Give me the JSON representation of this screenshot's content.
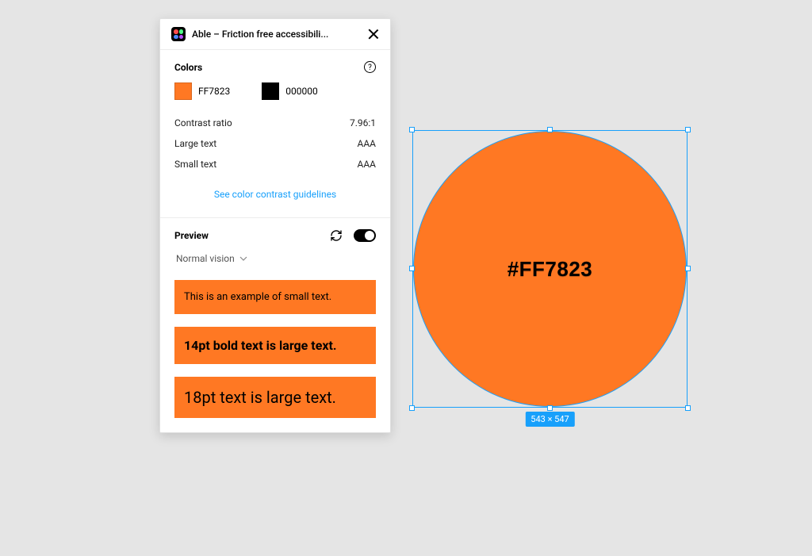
{
  "header": {
    "title": "Able – Friction free accessibili..."
  },
  "colors_section": {
    "title": "Colors",
    "help": "?",
    "color1": {
      "hex": "FF7823",
      "cssHex": "#FF7823"
    },
    "color2": {
      "hex": "000000",
      "cssHex": "#000000"
    },
    "metrics": {
      "contrast_label": "Contrast ratio",
      "contrast_value": "7.96:1",
      "large_label": "Large text",
      "large_value": "AAA",
      "small_label": "Small text",
      "small_value": "AAA"
    },
    "guidelines_link": "See color contrast guidelines"
  },
  "preview_section": {
    "title": "Preview",
    "vision_mode": "Normal vision",
    "samples": {
      "small": "This is an example of small text.",
      "bold": "14pt bold text is large text.",
      "large": "18pt text is large text."
    },
    "sample_bg": "#FF7823"
  },
  "canvas": {
    "fill": "#FF7823",
    "label": "#FF7823",
    "dimensions": "543 × 547"
  },
  "chart_data": {
    "type": "table",
    "title": "WCAG color contrast evaluation",
    "rows": [
      {
        "metric": "Contrast ratio",
        "value": "7.96:1"
      },
      {
        "metric": "Large text",
        "value": "AAA"
      },
      {
        "metric": "Small text",
        "value": "AAA"
      }
    ],
    "foreground": "#FF7823",
    "background": "#000000"
  }
}
